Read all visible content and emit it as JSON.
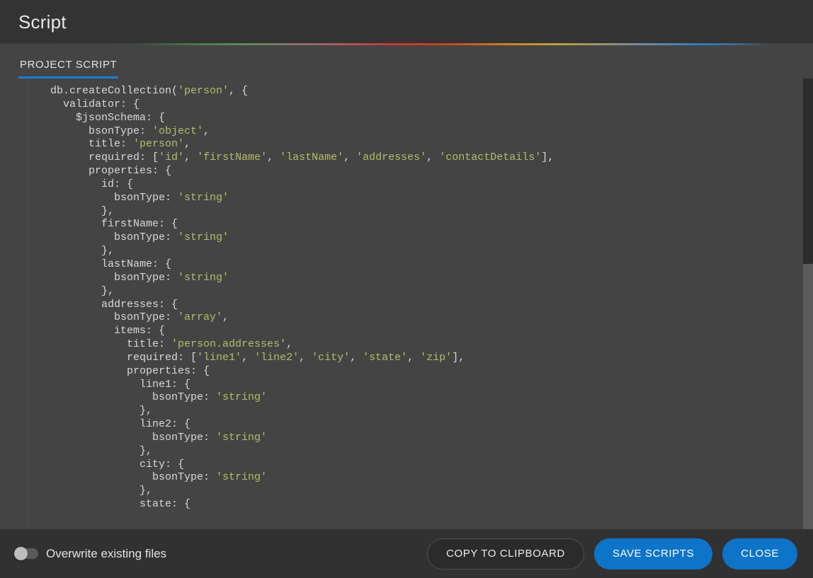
{
  "header": {
    "title": "Script"
  },
  "tabs": [
    {
      "label": "PROJECT SCRIPT",
      "active": true
    }
  ],
  "accent_color": "#1b7fd4",
  "editor": {
    "language": "javascript",
    "read_only": true,
    "scroll_position": "top",
    "lines": [
      "db.createCollection('person', {",
      "  validator: {",
      "    $jsonSchema: {",
      "      bsonType: 'object',",
      "      title: 'person',",
      "      required: ['id', 'firstName', 'lastName', 'addresses', 'contactDetails'],",
      "      properties: {",
      "        id: {",
      "          bsonType: 'string'",
      "        },",
      "        firstName: {",
      "          bsonType: 'string'",
      "        },",
      "        lastName: {",
      "          bsonType: 'string'",
      "        },",
      "        addresses: {",
      "          bsonType: 'array',",
      "          items: {",
      "            title: 'person.addresses',",
      "            required: ['line1', 'line2', 'city', 'state', 'zip'],",
      "            properties: {",
      "              line1: {",
      "                bsonType: 'string'",
      "              },",
      "              line2: {",
      "                bsonType: 'string'",
      "              },",
      "              city: {",
      "                bsonType: 'string'",
      "              },",
      "              state: {"
    ]
  },
  "footer": {
    "overwrite_toggle": {
      "label": "Overwrite existing files",
      "checked": false
    },
    "buttons": [
      {
        "label": "COPY TO CLIPBOARD",
        "style": "ghost"
      },
      {
        "label": "SAVE SCRIPTS",
        "style": "primary"
      },
      {
        "label": "CLOSE",
        "style": "primary"
      }
    ]
  }
}
